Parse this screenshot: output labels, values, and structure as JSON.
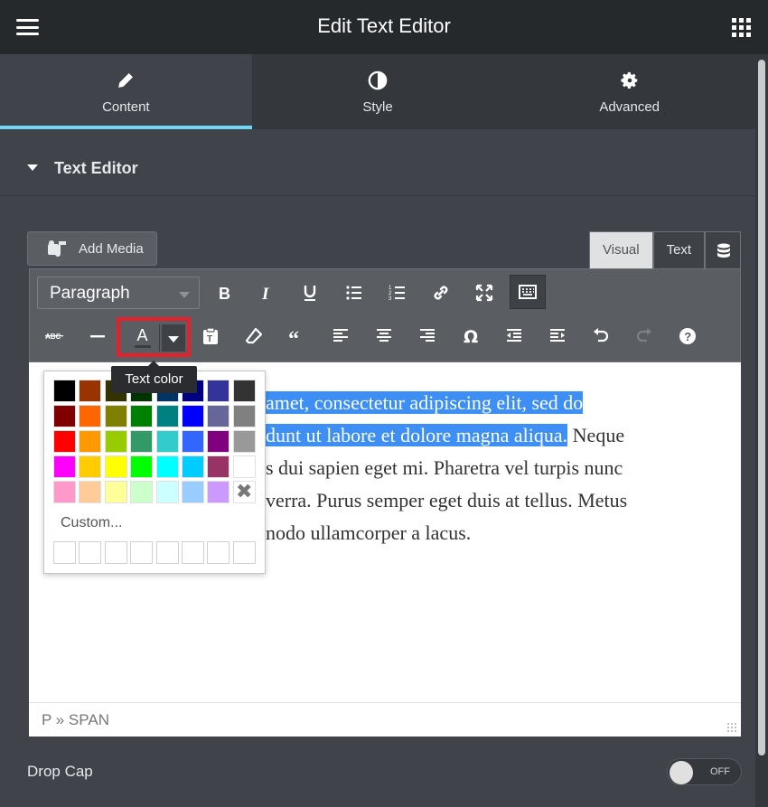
{
  "header": {
    "title": "Edit Text Editor"
  },
  "tabs": [
    {
      "label": "Content",
      "icon": "pencil-icon"
    },
    {
      "label": "Style",
      "icon": "contrast-icon"
    },
    {
      "label": "Advanced",
      "icon": "gear-icon"
    }
  ],
  "section": {
    "title": "Text Editor"
  },
  "editor": {
    "add_media_label": "Add Media",
    "mode_tabs": {
      "visual": "Visual",
      "text": "Text"
    },
    "format_select": "Paragraph",
    "tooltip": "Text color",
    "content_lines": [
      {
        "selected": "amet, consectetur adipiscing elit, sed do",
        "rest": ""
      },
      {
        "selected": "dunt ut labore et dolore magna aliqua.",
        "rest": " Neque"
      },
      {
        "selected": "",
        "rest": "s dui sapien eget mi. Pharetra vel turpis nunc"
      },
      {
        "selected": "",
        "rest": "verra. Purus semper eget duis at tellus. Metus"
      },
      {
        "selected": "",
        "rest": "nodo ullamcorper a lacus."
      }
    ],
    "status_path": "P » SPAN"
  },
  "color_panel": {
    "swatches": [
      "#000000",
      "#993300",
      "#333300",
      "#003300",
      "#003366",
      "#000080",
      "#333399",
      "#333333",
      "#800000",
      "#ff6600",
      "#808000",
      "#008000",
      "#008080",
      "#0000ff",
      "#666699",
      "#808080",
      "#ff0000",
      "#ff9900",
      "#99cc00",
      "#339966",
      "#33cccc",
      "#3366ff",
      "#800080",
      "#999999",
      "#ff00ff",
      "#ffcc00",
      "#ffff00",
      "#00ff00",
      "#00ffff",
      "#00ccff",
      "#993366",
      "#ffffff",
      "#ff99cc",
      "#ffcc99",
      "#ffff99",
      "#ccffcc",
      "#ccffff",
      "#99ccff",
      "#cc99ff",
      "remove"
    ],
    "custom_label": "Custom..."
  },
  "drop_cap": {
    "label": "Drop Cap",
    "toggle_state": "OFF"
  },
  "colors": {
    "accent": "#71d7f7",
    "selection": "#3d8ff5",
    "highlight_border": "#e6202b"
  }
}
